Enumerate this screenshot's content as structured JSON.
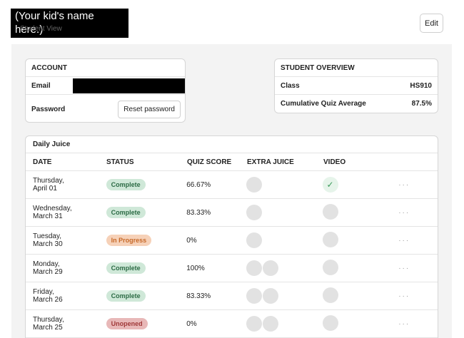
{
  "header": {
    "kid_name": "(Your kid's name here.)",
    "subtitle": "Student View",
    "edit_label": "Edit"
  },
  "account": {
    "title": "ACCOUNT",
    "email_label": "Email",
    "password_label": "Password",
    "reset_label": "Reset password"
  },
  "overview": {
    "title": "STUDENT OVERVIEW",
    "class_label": "Class",
    "class_value": "HS910",
    "avg_label": "Cumulative Quiz Average",
    "avg_value": "87.5%"
  },
  "juice": {
    "title": "Daily Juice",
    "columns": [
      "DATE",
      "STATUS",
      "QUIZ SCORE",
      "EXTRA JUICE",
      "VIDEO"
    ],
    "rows": [
      {
        "day": "Thursday,",
        "date": "April 01",
        "status": "Complete",
        "score": "66.67%",
        "extra_dots": 1,
        "video": "check"
      },
      {
        "day": "Wednesday,",
        "date": "March 31",
        "status": "Complete",
        "score": "83.33%",
        "extra_dots": 1,
        "video": "dot"
      },
      {
        "day": "Tuesday,",
        "date": "March 30",
        "status": "In Progress",
        "score": "0%",
        "extra_dots": 1,
        "video": "dot"
      },
      {
        "day": "Monday,",
        "date": "March 29",
        "status": "Complete",
        "score": "100%",
        "extra_dots": 2,
        "video": "dot"
      },
      {
        "day": "Friday,",
        "date": "March 26",
        "status": "Complete",
        "score": "83.33%",
        "extra_dots": 2,
        "video": "dot"
      },
      {
        "day": "Thursday,",
        "date": "March 25",
        "status": "Unopened",
        "score": "0%",
        "extra_dots": 2,
        "video": "dot"
      }
    ],
    "more_label": "···"
  }
}
